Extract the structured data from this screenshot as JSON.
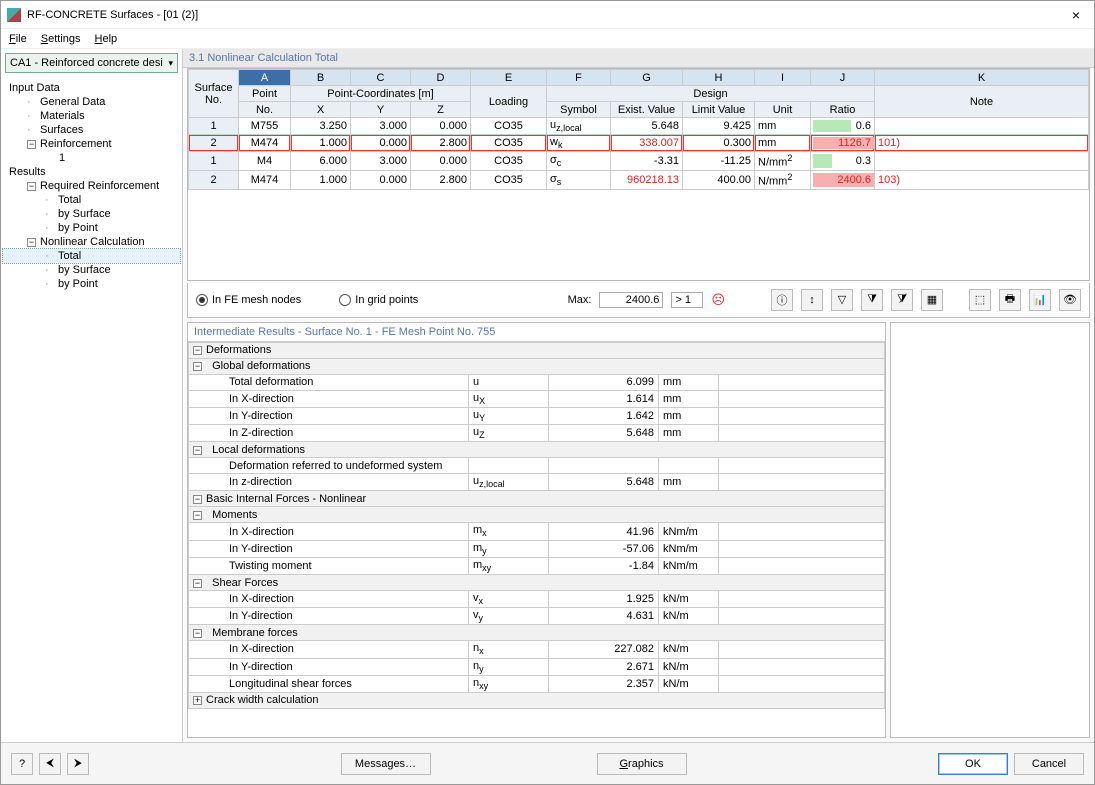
{
  "window": {
    "title": "RF-CONCRETE Surfaces - [01 (2)]"
  },
  "menu": {
    "file": "File",
    "settings": "Settings",
    "help": "Help"
  },
  "combo": {
    "text": "CA1 - Reinforced concrete desi"
  },
  "tree": {
    "inputData": "Input Data",
    "generalData": "General Data",
    "materials": "Materials",
    "surfaces": "Surfaces",
    "reinforcement": "Reinforcement",
    "reinf1": "1",
    "results": "Results",
    "reqReinf": "Required Reinforcement",
    "total": "Total",
    "bySurface": "by Surface",
    "byPoint": "by Point",
    "nonlinear": "Nonlinear Calculation"
  },
  "panel": {
    "title": "3.1 Nonlinear Calculation Total"
  },
  "letters": [
    "A",
    "B",
    "C",
    "D",
    "E",
    "F",
    "G",
    "H",
    "I",
    "J",
    "K"
  ],
  "hdr": {
    "surfaceNo": "Surface",
    "surfaceNo2": "No.",
    "point": "Point",
    "pointNo": "No.",
    "pc": "Point-Coordinates [m]",
    "x": "X",
    "y": "Y",
    "z": "Z",
    "loading": "Loading",
    "design": "Design",
    "symbol": "Symbol",
    "exist": "Exist. Value",
    "limit": "Limit Value",
    "unit": "Unit",
    "ratio": "Ratio",
    "note": "Note"
  },
  "rows": [
    {
      "s": "1",
      "p": "M755",
      "x": "3.250",
      "y": "3.000",
      "z": "0.000",
      "ld": "CO35",
      "sym": "u_z,local",
      "ev": "5.648",
      "lv": "9.425",
      "u": "mm",
      "r": "0.6",
      "rpct": 0.6,
      "note": ""
    },
    {
      "s": "2",
      "p": "M474",
      "x": "1.000",
      "y": "0.000",
      "z": "2.800",
      "ld": "CO35",
      "sym": "w_k",
      "ev": "338.007",
      "lv": "0.300",
      "u": "mm",
      "r": "1126.7",
      "rpct": 1,
      "note": "101)",
      "hl": true,
      "red": true
    },
    {
      "s": "1",
      "p": "M4",
      "x": "6.000",
      "y": "3.000",
      "z": "0.000",
      "ld": "CO35",
      "sym": "σ_c",
      "ev": "-3.31",
      "lv": "-11.25",
      "u": "N/mm²",
      "r": "0.3",
      "rpct": 0.3,
      "note": ""
    },
    {
      "s": "2",
      "p": "M474",
      "x": "1.000",
      "y": "0.000",
      "z": "2.800",
      "ld": "CO35",
      "sym": "σ_s",
      "ev": "960218.13",
      "lv": "400.00",
      "u": "N/mm²",
      "r": "2400.6",
      "rpct": 1,
      "note": "103)",
      "red": true
    }
  ],
  "opts": {
    "feNodes": "In FE mesh nodes",
    "gridPts": "In grid points",
    "max": "Max:",
    "maxval": "2400.6",
    "gt": "> 1"
  },
  "inter": {
    "title": "Intermediate Results  -  Surface No. 1 - FE Mesh Point No. 755",
    "sections": {
      "deform": "Deformations",
      "glob": "Global deformations",
      "loc": "Local deformations",
      "basic": "Basic Internal Forces - Nonlinear",
      "moments": "Moments",
      "shear": "Shear Forces",
      "membrane": "Membrane forces",
      "crack": "Crack width calculation"
    },
    "items": [
      {
        "lvl": 3,
        "lbl": "Total deformation",
        "sym": "u",
        "val": "6.099",
        "u": "mm"
      },
      {
        "lvl": 3,
        "lbl": "In X-direction",
        "sym": "u_X",
        "val": "1.614",
        "u": "mm"
      },
      {
        "lvl": 3,
        "lbl": "In Y-direction",
        "sym": "u_Y",
        "val": "1.642",
        "u": "mm"
      },
      {
        "lvl": 3,
        "lbl": "In Z-direction",
        "sym": "u_Z",
        "val": "5.648",
        "u": "mm"
      },
      {
        "lvl": 3,
        "lbl": "Deformation referred to undeformed system",
        "sym": "",
        "val": "",
        "u": ""
      },
      {
        "lvl": 3,
        "lbl": "In z-direction",
        "sym": "u_z,local",
        "val": "5.648",
        "u": "mm"
      },
      {
        "lvl": 3,
        "lbl": "In X-direction",
        "sym": "m_x",
        "val": "41.96",
        "u": "kNm/m"
      },
      {
        "lvl": 3,
        "lbl": "In Y-direction",
        "sym": "m_y",
        "val": "-57.06",
        "u": "kNm/m"
      },
      {
        "lvl": 3,
        "lbl": "Twisting moment",
        "sym": "m_xy",
        "val": "-1.84",
        "u": "kNm/m"
      },
      {
        "lvl": 3,
        "lbl": "In X-direction",
        "sym": "v_x",
        "val": "1.925",
        "u": "kN/m"
      },
      {
        "lvl": 3,
        "lbl": "In Y-direction",
        "sym": "v_y",
        "val": "4.631",
        "u": "kN/m"
      },
      {
        "lvl": 3,
        "lbl": "In X-direction",
        "sym": "n_x",
        "val": "227.082",
        "u": "kN/m"
      },
      {
        "lvl": 3,
        "lbl": "In Y-direction",
        "sym": "n_y",
        "val": "2.671",
        "u": "kN/m"
      },
      {
        "lvl": 3,
        "lbl": "Longitudinal shear forces",
        "sym": "n_xy",
        "val": "2.357",
        "u": "kN/m"
      }
    ]
  },
  "footer": {
    "messages": "Messages…",
    "graphics": "Graphics",
    "ok": "OK",
    "cancel": "Cancel"
  }
}
